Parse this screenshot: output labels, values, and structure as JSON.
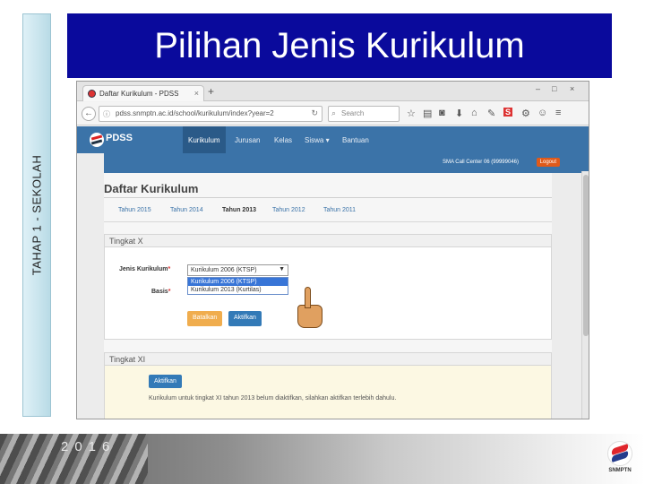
{
  "slide": {
    "title": "Pilihan Jenis Kurikulum",
    "side_label": "TAHAP 1 - SEKOLAH",
    "year": "2016",
    "logo_text": "SNMPTN"
  },
  "browser": {
    "tab_title": "Daftar Kurikulum - PDSS",
    "tab_close": "×",
    "new_tab": "+",
    "url": "pdss.snmptn.ac.id/school/kurikulum/index?year=2",
    "search_placeholder": "Search",
    "window_controls": [
      "–",
      "□",
      "×"
    ]
  },
  "app": {
    "brand": "PDSS",
    "menu": [
      "Kurikulum",
      "Jurusan",
      "Kelas",
      "Siswa ▾",
      "Bantuan"
    ],
    "user": "SMA Call Center 06 (99999046)",
    "logout": "Logout",
    "page_title": "Daftar Kurikulum",
    "year_tabs": [
      "Tahun 2015",
      "Tahun 2014",
      "Tahun 2013",
      "Tahun 2012",
      "Tahun 2011"
    ],
    "active_year_tab": "Tahun 2013",
    "panel_x": {
      "heading": "Tingkat X",
      "jenis_label": "Jenis Kurikulum",
      "basis_label": "Basis",
      "required_mark": "*",
      "selected": "Kurikulum 2006 (KTSP)",
      "options": [
        "Kurikulum 2006 (KTSP)",
        "Kurikulum 2013 (Kurtilas)"
      ],
      "btn_cancel": "Batalkan",
      "btn_activate": "Aktifkan"
    },
    "panel_xi": {
      "heading": "Tingkat XI",
      "btn_activate": "Aktifkan",
      "note": "Kurikulum untuk tingkat XI tahun 2013 belum diaktifkan, silahkan aktifkan terlebih dahulu."
    }
  },
  "colors": {
    "title_bar": "#0a0a9c",
    "app_header": "#3b73a8",
    "logout": "#e05a1a",
    "btn_cancel": "#f0ad4e",
    "btn_activate": "#337ab7"
  }
}
